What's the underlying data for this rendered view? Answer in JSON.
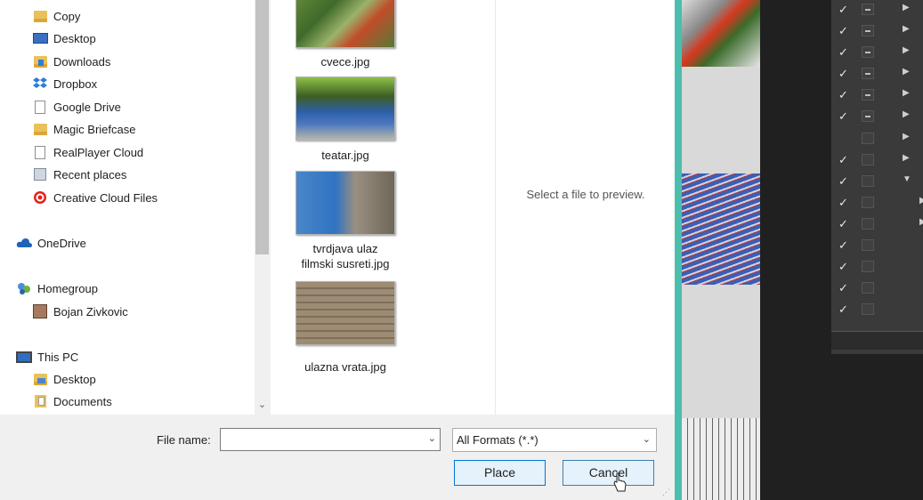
{
  "nav": {
    "items": [
      {
        "label": "Copy",
        "icon": "folder-icon"
      },
      {
        "label": "Desktop",
        "icon": "desktop-icon"
      },
      {
        "label": "Downloads",
        "icon": "downloads-folder-icon"
      },
      {
        "label": "Dropbox",
        "icon": "dropbox-icon"
      },
      {
        "label": "Google Drive",
        "icon": "file-icon"
      },
      {
        "label": "Magic Briefcase",
        "icon": "folder-icon"
      },
      {
        "label": "RealPlayer Cloud",
        "icon": "file-icon"
      },
      {
        "label": "Recent places",
        "icon": "recent-places-icon"
      },
      {
        "label": "Creative Cloud Files",
        "icon": "creative-cloud-icon"
      },
      {
        "label": "OneDrive",
        "icon": "onedrive-icon"
      },
      {
        "label": "Homegroup",
        "icon": "homegroup-icon"
      },
      {
        "label": "Bojan Zivkovic",
        "icon": "user-avatar-icon"
      },
      {
        "label": "This PC",
        "icon": "this-pc-icon"
      },
      {
        "label": "Desktop",
        "icon": "desktop-folder-icon"
      },
      {
        "label": "Documents",
        "icon": "documents-folder-icon"
      }
    ]
  },
  "files": [
    {
      "name": "cvece.jpg"
    },
    {
      "name": "teatar.jpg"
    },
    {
      "name": "tvrdjava ulaz\nfilmski susreti.jpg"
    },
    {
      "name": "ulazna vrata.jpg"
    }
  ],
  "preview": {
    "placeholder": "Select a file to preview."
  },
  "footer": {
    "file_name_label": "File name:",
    "file_name_value": "",
    "format_selected": "All Formats (*.*)",
    "place_label": "Place",
    "cancel_label": "Cancel"
  },
  "colors": {
    "accent": "#4dbdae",
    "button_border": "#0078d7"
  }
}
